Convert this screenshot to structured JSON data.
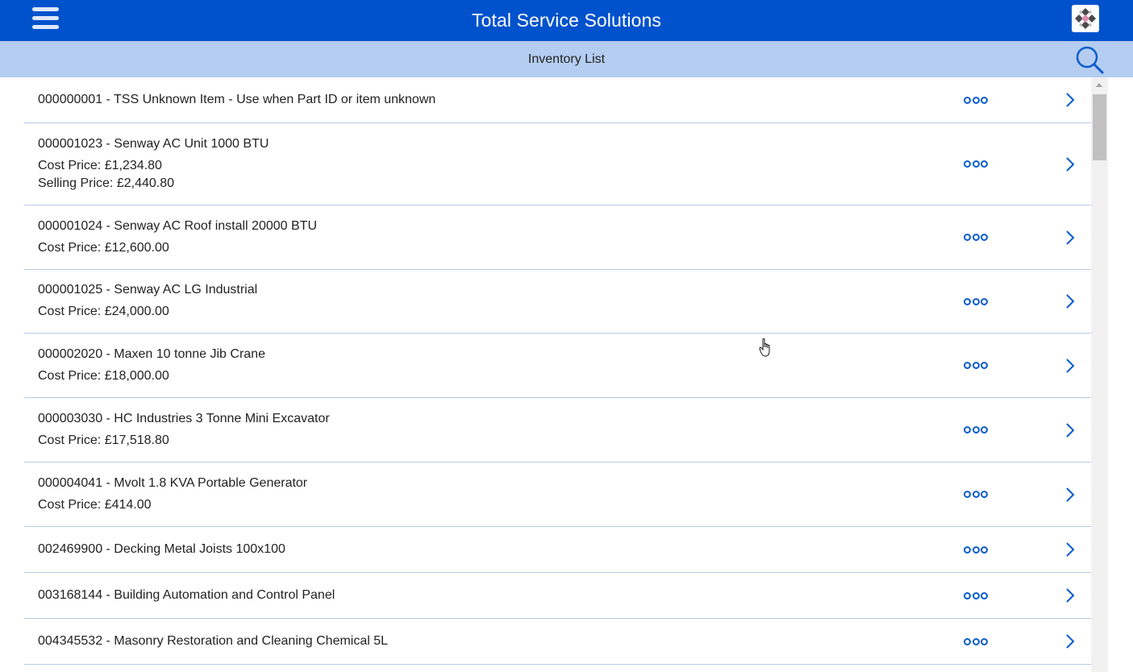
{
  "header": {
    "title": "Total Service Solutions",
    "menu_icon": "hamburger-menu-icon",
    "logo_icon": "app-logo-icon",
    "brand_color": "#0052cc"
  },
  "subheader": {
    "title": "Inventory List",
    "search_icon": "search-icon",
    "background": "#b4cdf0"
  },
  "items": [
    {
      "title": "000000001 - TSS Unknown Item - Use when Part ID or item unknown",
      "cost": "",
      "selling": ""
    },
    {
      "title": "000001023 - Senway AC Unit 1000 BTU",
      "cost": "Cost Price: £1,234.80",
      "selling": "Selling Price: £2,440.80"
    },
    {
      "title": "000001024 - Senway AC Roof install 20000 BTU",
      "cost": "Cost Price: £12,600.00",
      "selling": ""
    },
    {
      "title": "000001025 - Senway AC LG Industrial",
      "cost": "Cost Price: £24,000.00",
      "selling": ""
    },
    {
      "title": "000002020 - Maxen 10 tonne Jib Crane",
      "cost": "Cost Price: £18,000.00",
      "selling": ""
    },
    {
      "title": "000003030 - HC Industries 3 Tonne Mini Excavator",
      "cost": "Cost Price: £17,518.80",
      "selling": ""
    },
    {
      "title": "000004041 - Mvolt 1.8 KVA Portable Generator",
      "cost": "Cost Price: £414.00",
      "selling": ""
    },
    {
      "title": "002469900 - Decking Metal Joists 100x100",
      "cost": "",
      "selling": ""
    },
    {
      "title": "003168144 - Building Automation and Control Panel",
      "cost": "",
      "selling": ""
    },
    {
      "title": "004345532 - Masonry Restoration and Cleaning Chemical 5L",
      "cost": "",
      "selling": ""
    }
  ],
  "row_icons": {
    "more": "more-options-icon",
    "open": "chevron-right-icon"
  },
  "accent_color": "#0a5ccc"
}
